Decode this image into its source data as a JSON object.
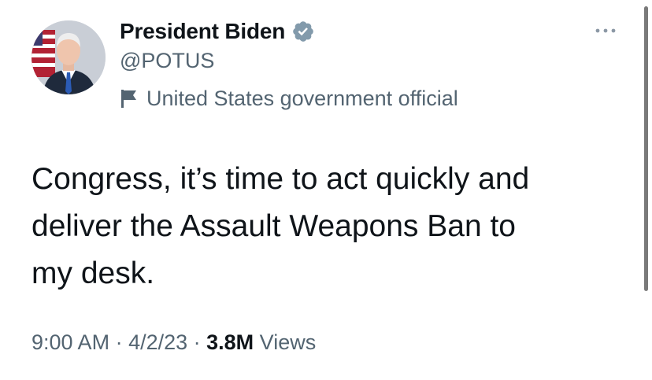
{
  "tweet": {
    "author": {
      "display_name": "President Biden",
      "handle": "@POTUS",
      "verified_icon": "verified-badge-icon",
      "label": "United States government official",
      "label_icon": "flag-icon",
      "avatar": "profile-photo"
    },
    "more_icon": "more-options-icon",
    "text_lines": [
      "Congress, it’s time to act quickly and",
      "deliver the Assault Weapons Ban to",
      "my desk."
    ],
    "meta": {
      "time": "9:00 AM",
      "separator": " · ",
      "date": "4/2/23",
      "views_count": "3.8M",
      "views_label": " Views"
    }
  },
  "colors": {
    "text_primary": "#0f1419",
    "text_secondary": "#536471",
    "verified_badge": "#829aab",
    "background": "#ffffff"
  }
}
